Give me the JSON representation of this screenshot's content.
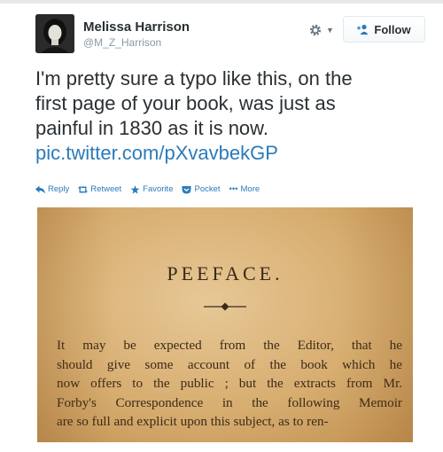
{
  "tweet": {
    "author_name": "Melissa Harrison",
    "author_handle": "@M_Z_Harrison",
    "follow_label": "Follow",
    "text_lines": [
      "I'm pretty sure a typo like this, on the",
      "first page of your book, was just as",
      "painful in 1830 as it is now."
    ],
    "link": "pic.twitter.com/pXvavbekGP"
  },
  "actions": {
    "reply": "Reply",
    "retweet": "Retweet",
    "favorite": "Favorite",
    "pocket": "Pocket",
    "more": "More"
  },
  "photo": {
    "heading": "PEEFACE.",
    "lines": [
      "It may be expected from the Editor, that he",
      "should give some account of the book which he",
      "now offers to the public ; but the extracts from Mr.",
      "Forby's Correspondence in the following Memoir",
      "are so full and explicit upon this subject, as to ren-"
    ]
  },
  "colors": {
    "link": "#2b7bb9",
    "text": "#292f33",
    "muted": "#8899a6",
    "page_paper": "#d9b075"
  },
  "icons": [
    "gear-icon",
    "follow-person-icon",
    "reply-icon",
    "retweet-icon",
    "favorite-star-icon",
    "pocket-icon",
    "more-dots-icon"
  ]
}
